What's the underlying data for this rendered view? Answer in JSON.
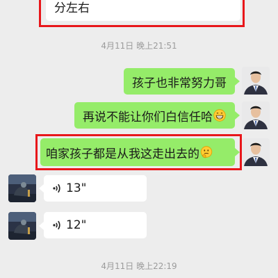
{
  "messages": {
    "top_left_text": "分左右",
    "time_1": "4月11日 晚上21:51",
    "msg_1": "孩子也非常努力哥",
    "msg_2": "再说不能让你们白信任哈",
    "msg_3": "咱家孩子都是从我这走出去的",
    "voice_1": "13\"",
    "voice_2": "12\"",
    "time_2": "4月11日 晚上22:19"
  },
  "icons": {
    "msg_2_emoji": "grinning-face-emoji",
    "msg_3_emoji": "thinking-face-emoji",
    "voice": "voice-wave-icon"
  },
  "colors": {
    "sent_bubble": "#95ec69",
    "received_bubble": "#ffffff",
    "highlight_border": "#e8161a",
    "background": "#ededed"
  }
}
